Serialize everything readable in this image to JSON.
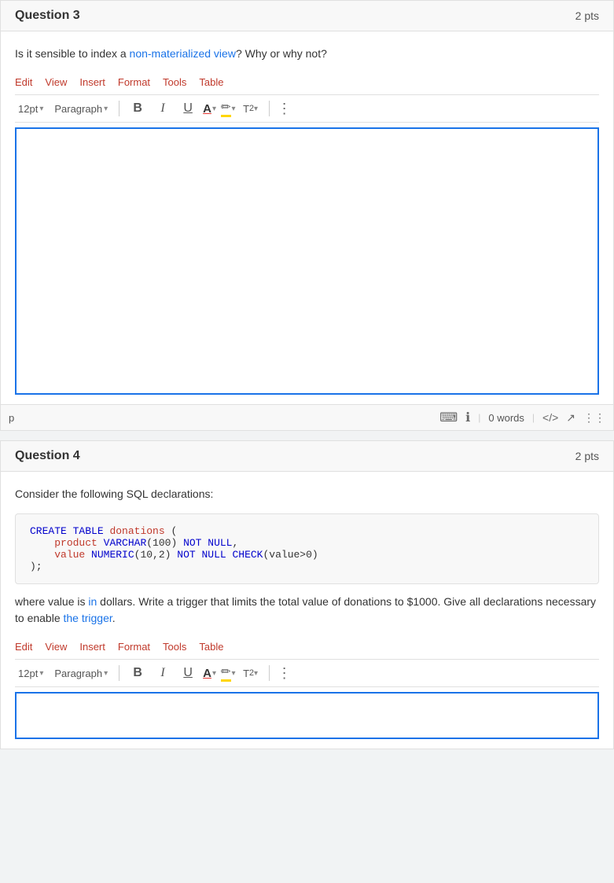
{
  "question3": {
    "title": "Question 3",
    "points": "2 pts",
    "text_parts": [
      {
        "text": "Is it sensible to index a ",
        "highlight": false
      },
      {
        "text": "non-materialized view",
        "highlight": true
      },
      {
        "text": "? Why or why not?",
        "highlight": false
      }
    ],
    "menu": {
      "items": [
        "Edit",
        "View",
        "Insert",
        "Format",
        "Tools",
        "Table"
      ]
    },
    "toolbar": {
      "font_size": "12pt",
      "paragraph": "Paragraph",
      "bold": "B",
      "italic": "I",
      "underline": "U"
    },
    "status_bar": {
      "element": "p",
      "word_count": "0 words"
    }
  },
  "question4": {
    "title": "Question 4",
    "points": "2 pts",
    "text_before": "Consider the following SQL declarations:",
    "code": [
      "CREATE TABLE donations (",
      "    product VARCHAR(100) NOT NULL,",
      "    value NUMERIC(10,2) NOT NULL CHECK(value>0)",
      ");"
    ],
    "text_after_parts": [
      {
        "text": "where value is ",
        "highlight": false
      },
      {
        "text": "in",
        "highlight": true
      },
      {
        "text": " dollars. Write a trigger that limits the total value of donations to $1000. Give all declarations necessary to enable ",
        "highlight": false
      },
      {
        "text": "the trigger",
        "highlight": true
      },
      {
        "text": ".",
        "highlight": false
      }
    ],
    "menu": {
      "items": [
        "Edit",
        "View",
        "Insert",
        "Format",
        "Tools",
        "Table"
      ]
    },
    "toolbar": {
      "font_size": "12pt",
      "paragraph": "Paragraph",
      "bold": "B",
      "italic": "I",
      "underline": "U"
    }
  }
}
